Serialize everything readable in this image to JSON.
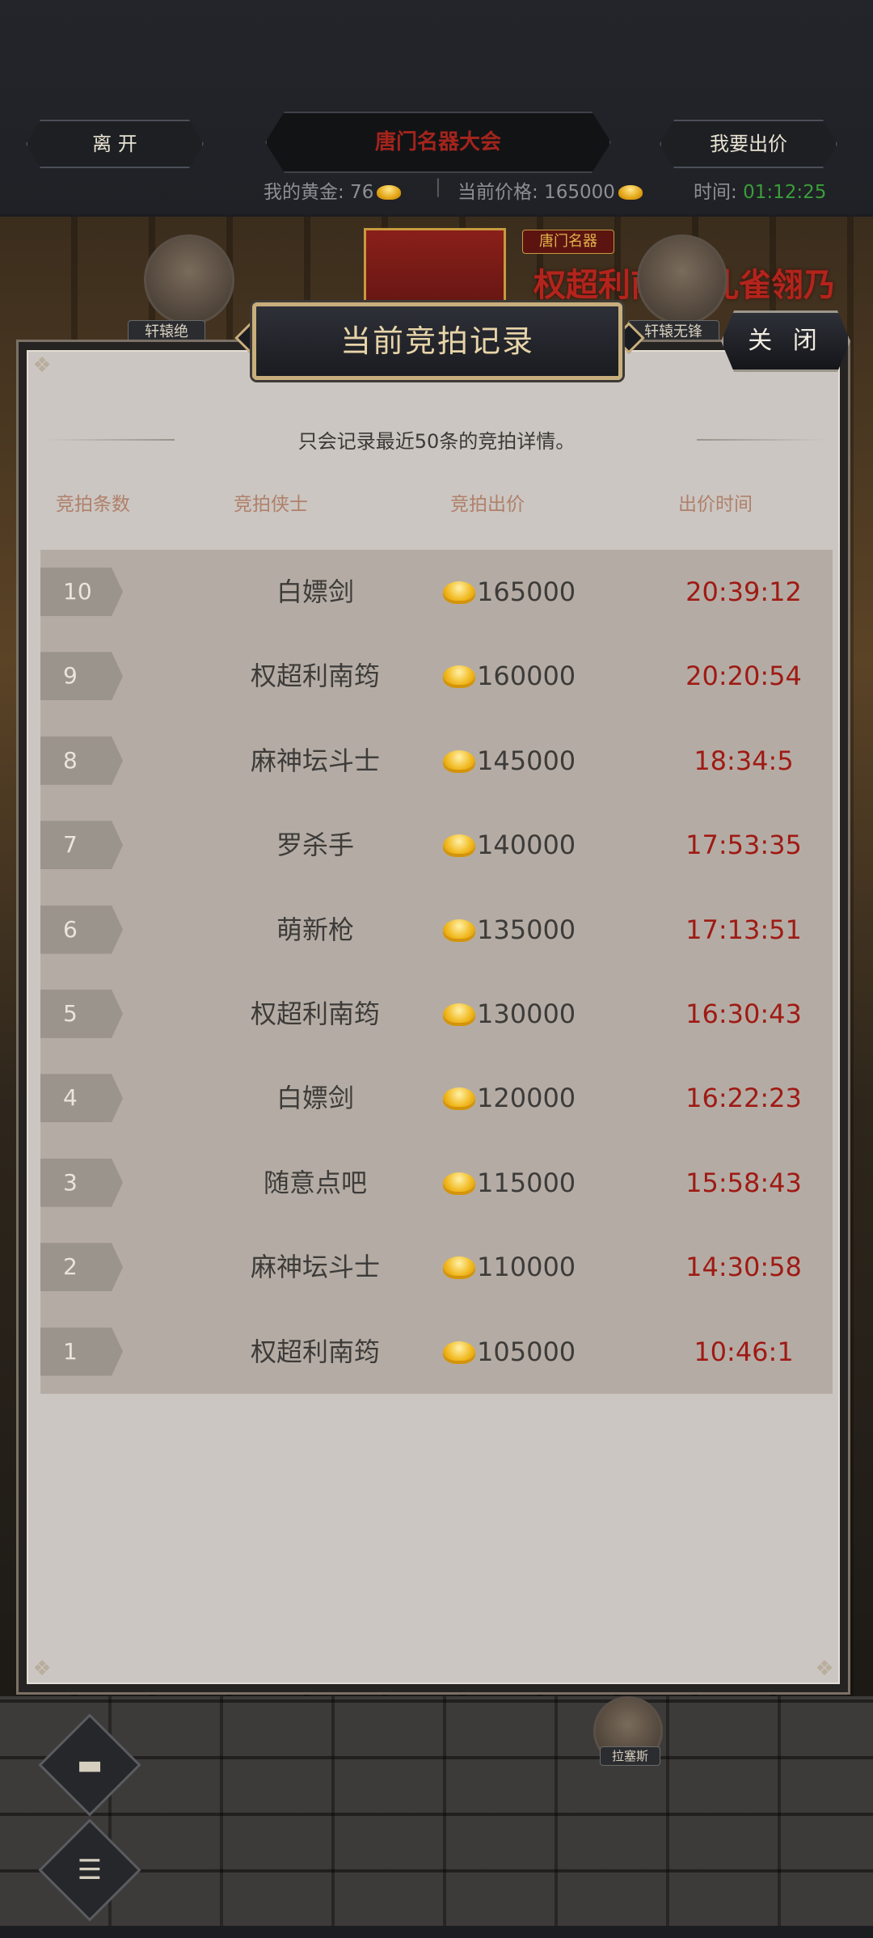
{
  "hud": {
    "leave_label": "离 开",
    "title": "唐门名器大会",
    "bid_label": "我要出价",
    "gold_label": "我的黄金: 76",
    "price_label": "当前价格: 165000",
    "time_label": "时间: ",
    "time_value": "01:12:25"
  },
  "scene": {
    "scroll_text": "权超利南筠 孔雀翎乃",
    "banner_text": "唐门名器",
    "plate_left": "轩辕绝",
    "plate_right": "轩辕无锋",
    "plate_bottom": "拉塞斯"
  },
  "modal": {
    "title": "当前竞拍记录",
    "close_label": "关 闭",
    "notice": "只会记录最近50条的竞拍详情。",
    "headers": [
      "竞拍条数",
      "竞拍侠士",
      "竞拍出价",
      "出价时间"
    ],
    "rows": [
      {
        "rank": "10",
        "name": "白嫖剑",
        "price": "165000",
        "time": "20:39:12"
      },
      {
        "rank": "9",
        "name": "权超利南筠",
        "price": "160000",
        "time": "20:20:54"
      },
      {
        "rank": "8",
        "name": "麻神坛斗士",
        "price": "145000",
        "time": "18:34:5"
      },
      {
        "rank": "7",
        "name": "罗杀手",
        "price": "140000",
        "time": "17:53:35"
      },
      {
        "rank": "6",
        "name": "萌新枪",
        "price": "135000",
        "time": "17:13:51"
      },
      {
        "rank": "5",
        "name": "权超利南筠",
        "price": "130000",
        "time": "16:30:43"
      },
      {
        "rank": "4",
        "name": "白嫖剑",
        "price": "120000",
        "time": "16:22:23"
      },
      {
        "rank": "3",
        "name": "随意点吧",
        "price": "115000",
        "time": "15:58:43"
      },
      {
        "rank": "2",
        "name": "麻神坛斗士",
        "price": "110000",
        "time": "14:30:58"
      },
      {
        "rank": "1",
        "name": "权超利南筠",
        "price": "105000",
        "time": "10:46:1"
      }
    ]
  },
  "colors": {
    "time_red": "#9f1a14",
    "header_tan": "#b0806a",
    "title_gold": "#e7d4a8"
  }
}
